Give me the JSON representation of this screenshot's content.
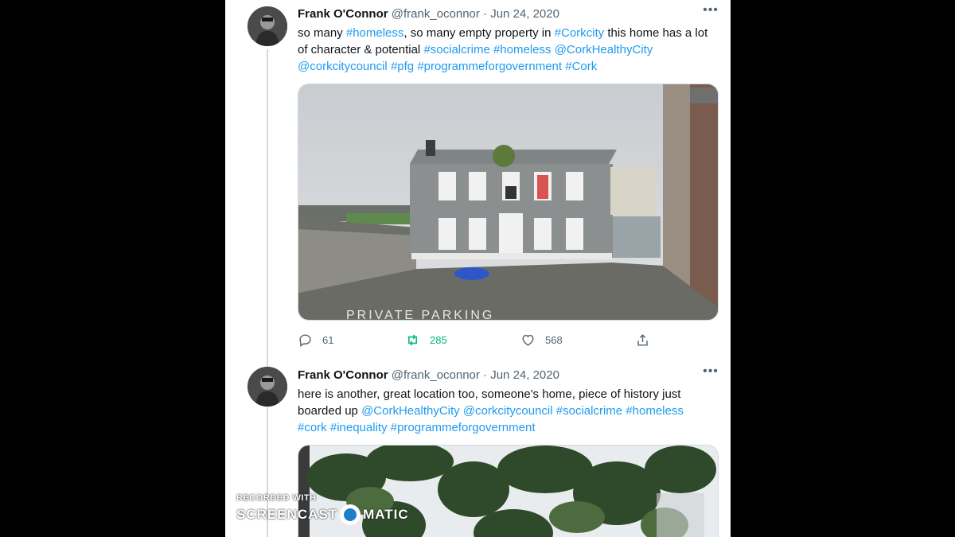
{
  "tweets": [
    {
      "name": "Frank O'Connor",
      "handle": "@frank_oconnor",
      "separator": "·",
      "date": "Jun 24, 2020",
      "more": "•••",
      "text_parts": [
        {
          "t": "so many ",
          "tag": false
        },
        {
          "t": "#homeless",
          "tag": true
        },
        {
          "t": ", so many empty property in ",
          "tag": false
        },
        {
          "t": "#Corkcity",
          "tag": true
        },
        {
          "t": " this home has a lot of character & potential ",
          "tag": false
        },
        {
          "t": "#socialcrime",
          "tag": true
        },
        {
          "t": " ",
          "tag": false
        },
        {
          "t": "#homeless",
          "tag": true
        },
        {
          "t": " ",
          "tag": false
        },
        {
          "t": "@CorkHealthyCity",
          "tag": true
        },
        {
          "t": " ",
          "tag": false
        },
        {
          "t": "@corkcitycouncil",
          "tag": true
        },
        {
          "t": " ",
          "tag": false
        },
        {
          "t": "#pfg",
          "tag": true
        },
        {
          "t": " ",
          "tag": false
        },
        {
          "t": "#programmeforgovernment",
          "tag": true
        },
        {
          "t": " ",
          "tag": false
        },
        {
          "t": "#Cork",
          "tag": true
        }
      ],
      "image_caption": "PRIVATE PARKING",
      "replies": "61",
      "retweets": "285",
      "likes": "568"
    },
    {
      "name": "Frank O'Connor",
      "handle": "@frank_oconnor",
      "separator": "·",
      "date": "Jun 24, 2020",
      "more": "•••",
      "text_parts": [
        {
          "t": "here is another, great location too, someone's home, piece of history just boarded up ",
          "tag": false
        },
        {
          "t": "@CorkHealthyCity",
          "tag": true
        },
        {
          "t": " ",
          "tag": false
        },
        {
          "t": "@corkcitycouncil",
          "tag": true
        },
        {
          "t": " ",
          "tag": false
        },
        {
          "t": "#socialcrime",
          "tag": true
        },
        {
          "t": " ",
          "tag": false
        },
        {
          "t": "#homeless",
          "tag": true
        },
        {
          "t": " ",
          "tag": false
        },
        {
          "t": "#cork",
          "tag": true
        },
        {
          "t": " ",
          "tag": false
        },
        {
          "t": "#inequality",
          "tag": true
        },
        {
          "t": " ",
          "tag": false
        },
        {
          "t": "#programmeforgovernment",
          "tag": true
        }
      ]
    }
  ],
  "watermark": {
    "line1": "RECORDED WITH",
    "left": "SCREENCAST",
    "right": "MATIC"
  },
  "colors": {
    "link": "#1d9bf0",
    "retweet": "#00ba7c",
    "muted": "#536471"
  },
  "icons": {
    "reply": "reply-icon",
    "retweet": "retweet-icon",
    "like": "heart-icon",
    "share": "share-icon",
    "more": "more-icon"
  }
}
